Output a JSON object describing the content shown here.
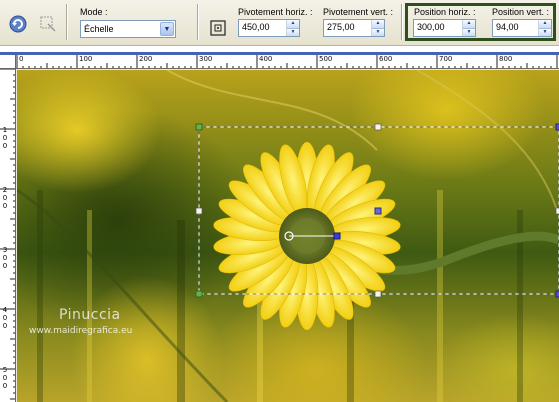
{
  "toolbar": {
    "mode_label": "Mode :",
    "mode_value": "Échelle",
    "pivot_h_label": "Pivotement horiz. :",
    "pivot_h_value": "450,00",
    "pivot_v_label": "Pivotement vert. :",
    "pivot_v_value": "275,00",
    "pos_h_label": "Position horiz. :",
    "pos_h_value": "300,00",
    "pos_v_label": "Position vert. :",
    "pos_v_value": "94,00",
    "highlight_color": "#2f4f1e"
  },
  "ruler": {
    "h_labels": [
      "0",
      "100",
      "200",
      "300",
      "400",
      "500",
      "600",
      "700",
      "800"
    ],
    "v_labels": [
      "1\n0\n0",
      "2\n0\n0",
      "3\n0\n0",
      "4\n0\n0",
      "5\n0\n0"
    ]
  },
  "canvas": {
    "watermark_name": "Pinuccia",
    "watermark_url": "www.maidiregrafica.eu"
  },
  "colors": {
    "selection_handle": "#6ab04c",
    "pivot_handle": "#3b3bd6",
    "ruler_bar": "#4463b8"
  }
}
